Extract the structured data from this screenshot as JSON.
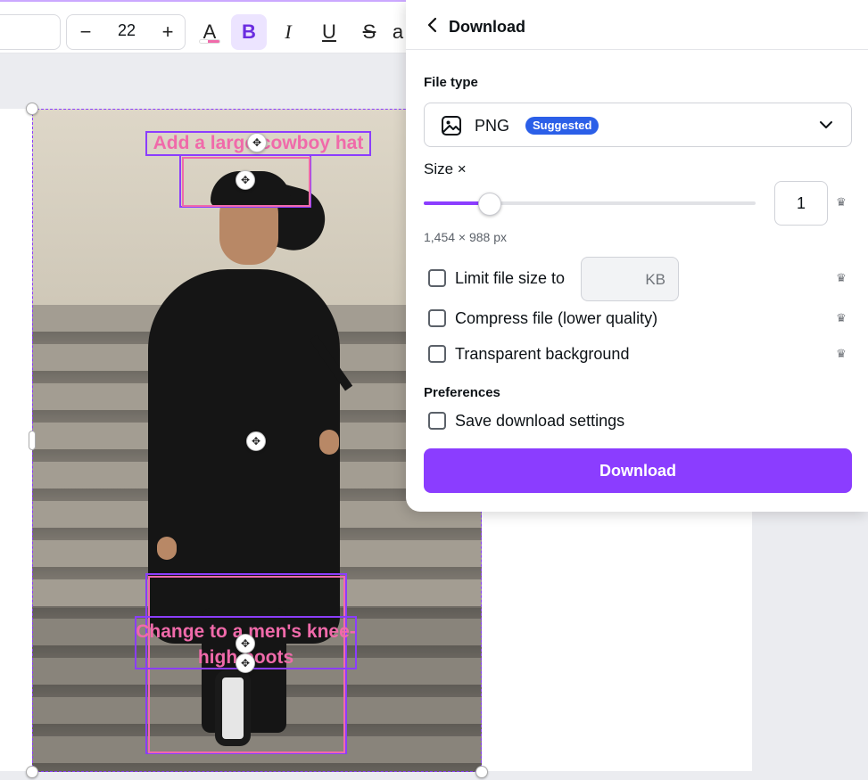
{
  "toolbar": {
    "font_size": "22",
    "minus_label": "−",
    "plus_label": "+",
    "text_color_label": "A",
    "bold_label": "B",
    "italic_label": "I",
    "underline_label": "U",
    "strike_label": "S",
    "case_label": "a"
  },
  "canvas": {
    "overlay_top_text": "Add a large cowboy hat",
    "overlay_bottom_text": "Change to a men's knee-high boots"
  },
  "download_panel": {
    "title": "Download",
    "file_type_label": "File type",
    "file_type_value": "PNG",
    "suggested_badge": "Suggested",
    "size_label": "Size ×",
    "size_value": "1",
    "size_slider_fraction": 0.2,
    "dimensions": "1,454 × 988 px",
    "limit_file_size_label": "Limit file size to",
    "kb_placeholder": "KB",
    "compress_label": "Compress file (lower quality)",
    "transparent_label": "Transparent background",
    "preferences_label": "Preferences",
    "save_settings_label": "Save download settings",
    "download_button": "Download"
  },
  "colors": {
    "accent": "#8b3dff",
    "badge": "#2b5fe8",
    "overlay_text": "#f06aaa"
  },
  "icons": [
    "chevron-left-icon",
    "image-icon",
    "chevron-down-icon",
    "crown-icon",
    "move-icon"
  ]
}
